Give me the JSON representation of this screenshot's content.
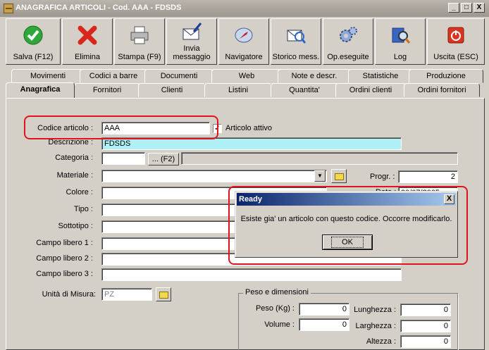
{
  "window": {
    "title": "ANAGRAFICA ARTICOLI - Cod. AAA - FDSDS",
    "min": "_",
    "max": "□",
    "close": "X"
  },
  "toolbar": [
    {
      "label": "Salva (F12)",
      "icon": "save-check-icon"
    },
    {
      "label": "Elimina",
      "icon": "delete-x-icon"
    },
    {
      "label": "Stampa (F9)",
      "icon": "printer-icon"
    },
    {
      "label": "Invia\nmessaggio",
      "icon": "send-message-icon"
    },
    {
      "label": "Navigatore",
      "icon": "compass-icon"
    },
    {
      "label": "Storico mess.",
      "icon": "message-history-icon"
    },
    {
      "label": "Op.eseguite",
      "icon": "gears-icon"
    },
    {
      "label": "Log",
      "icon": "log-search-icon"
    },
    {
      "label": "Uscita (ESC)",
      "icon": "exit-icon"
    }
  ],
  "tabs_row1": [
    "Movimenti",
    "Codici a barre",
    "Documenti",
    "Web",
    "Note e descr.",
    "Statistiche",
    "Produzione"
  ],
  "tabs_row2": [
    "Anagrafica",
    "Fornitori",
    "Clienti",
    "Listini",
    "Quantita'",
    "Ordini clienti",
    "Ordini fornitori"
  ],
  "form": {
    "codice_label": "Codice articolo :",
    "codice_value": "AAA",
    "attivo_label": "Articolo attivo",
    "attivo_checked": "✓",
    "descrizione_label": "Descrizione :",
    "descrizione_value": "FDSDS",
    "categoria_label": "Categoria :",
    "categoria_btn": "... (F2)",
    "materiale_label": "Materiale :",
    "colore_label": "Colore :",
    "tipo_label": "Tipo :",
    "sottotipo_label": "Sottotipo :",
    "campo1_label": "Campo libero 1 :",
    "campo2_label": "Campo libero 2 :",
    "campo3_label": "Campo libero 3 :",
    "unita_label": "Unità di Misura:",
    "unita_value": "PZ",
    "progr_label": "Progr. :",
    "progr_value": "2",
    "data_label": "Data :",
    "data_value": "30/07/2005"
  },
  "peso": {
    "group_title": "Peso e dimensioni",
    "peso_label": "Peso (Kg) :",
    "peso_value": "0",
    "volume_label": "Volume :",
    "volume_value": "0",
    "lunghezza_label": "Lunghezza :",
    "lunghezza_value": "0",
    "larghezza_label": "Larghezza :",
    "larghezza_value": "0",
    "altezza_label": "Altezza :",
    "altezza_value": "0"
  },
  "dialog": {
    "title": "Ready",
    "close": "X",
    "message": "Esiste gia' un articolo con questo codice. Occorre modificarlo.",
    "ok": "OK"
  },
  "colors": {
    "highlight": "#e0141e",
    "accent_cyan": "#aef0f5",
    "dialog_title": "#0a246a"
  }
}
